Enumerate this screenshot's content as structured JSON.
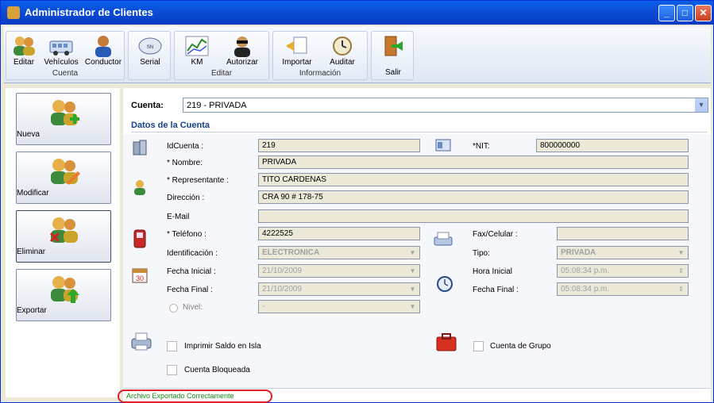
{
  "window": {
    "title": "Administrador de Clientes",
    "minimize": "_",
    "maximize": "□",
    "close": "✕"
  },
  "ribbon": {
    "groups": [
      {
        "label": "Cuenta",
        "buttons": [
          "Editar",
          "Vehículos",
          "Conductor"
        ]
      },
      {
        "label": "",
        "buttons": [
          "Serial"
        ]
      },
      {
        "label": "Editar",
        "buttons": [
          "KM",
          "Autorizar"
        ]
      },
      {
        "label": "Información",
        "buttons": [
          "Importar",
          "Auditar"
        ]
      },
      {
        "label": "",
        "buttons": [
          "Salir"
        ]
      }
    ]
  },
  "sidebar": {
    "buttons": [
      "Nueva",
      "Modificar",
      "Eliminar",
      "Exportar"
    ]
  },
  "cuenta": {
    "label": "Cuenta:",
    "value": "219 - PRIVADA"
  },
  "section": {
    "title": "Datos de la Cuenta"
  },
  "form": {
    "id_label": "IdCuenta :",
    "id_value": "219",
    "nit_label": "*NIT:",
    "nit_value": "800000000",
    "nombre_label": "* Nombre:",
    "nombre_value": "PRIVADA",
    "rep_label": "* Representante :",
    "rep_value": "TITO CARDENAS",
    "dir_label": "Dirección :",
    "dir_value": "CRA 90 # 178-75",
    "email_label": "E-Mail",
    "email_value": "",
    "tel_label": "* Teléfono :",
    "tel_value": "4222525",
    "fax_label": "Fax/Celular :",
    "fax_value": "",
    "ident_label": "Identificación :",
    "ident_value": "ELECTRONICA",
    "tipo_label": "Tipo:",
    "tipo_value": "PRIVADA",
    "fi_label": "Fecha Inicial :",
    "fi_value": "21/10/2009",
    "hi_label": "Hora Inicial",
    "hi_value": "05:08:34 p.m.",
    "ff_label": "Fecha Final :",
    "ff_value": "21/10/2009",
    "hf_label": "Fecha Final :",
    "hf_value": "05:08:34 p.m.",
    "nivel_label": "Nivel:",
    "nivel_value": "-",
    "imprimir_label": "Imprimir Saldo en Isla",
    "grupo_label": "Cuenta de Grupo",
    "bloqueada_label": "Cuenta Bloqueada"
  },
  "status": {
    "text": "Archivo Exportado Correctamente",
    "color": "#1a8a1a"
  },
  "colors": {
    "title_bar": "#0a4ed8",
    "section_title": "#15428b",
    "highlight_oval": "#e0202a"
  }
}
